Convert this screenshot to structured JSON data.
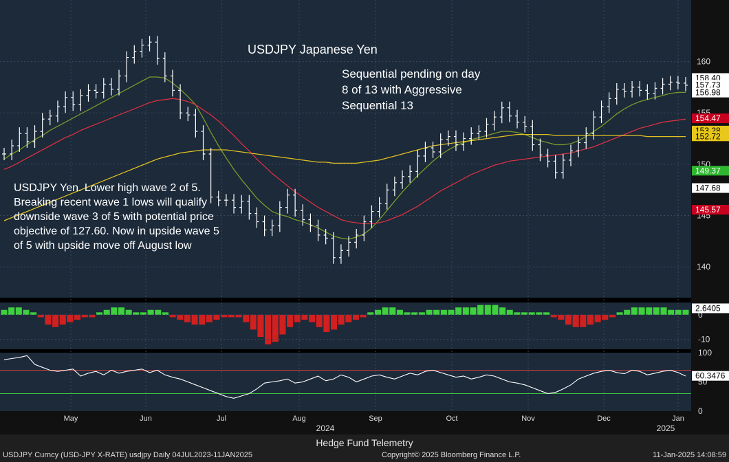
{
  "header": {
    "title": "USDJPY Japanese Yen",
    "sequential_note": [
      "Sequential pending on day",
      "8 of 13 with Aggressive",
      "Sequential 13"
    ],
    "wave_note": [
      "USDJPY Yen.  Lower high wave 2 of 5.",
      "Breaking recent wave 1 lows will qualify",
      "downside wave 3 of 5 with potential price",
      "objective of 127.60.  Now in upside wave 5",
      "of 5 with upside move off August low"
    ]
  },
  "footer": {
    "center": "Hedge Fund Telemetry",
    "security": "USDJPY Curncy (USD-JPY X-RATE) usdjpy  Daily 04JUL2023-11JAN2025",
    "copyright": "Copyright© 2025 Bloomberg Finance L.P.",
    "timestamp": "11-Jan-2025 14:08:59"
  },
  "colors": {
    "background": "#1c2a3a",
    "grid": "#3a4a5a",
    "price": "#ffffff",
    "ma_short": "#7a9a2a",
    "ma_mid": "#d83040",
    "ma_long": "#e0c020",
    "hist_pos": "#3fcf3f",
    "hist_neg": "#d02020",
    "rsi": "#ffffff",
    "label_red": "#c8001e",
    "label_yellow": "#e8c81a",
    "label_green": "#2fb82f",
    "label_white": "#ffffff"
  },
  "chart_data": [
    {
      "type": "line",
      "panel": "price",
      "x_ticks": [
        "May",
        "Jun",
        "Jul",
        "Aug",
        "Sep",
        "Oct",
        "Nov",
        "Dec",
        "Jan"
      ],
      "year_labels": [
        "2024",
        "2025"
      ],
      "ylim": [
        137,
        166
      ],
      "y_ticks": [
        140,
        145,
        150,
        155,
        160
      ],
      "price_labels": [
        {
          "value": "158.40",
          "color": "label_white"
        },
        {
          "value": "157.73",
          "color": "label_white"
        },
        {
          "value": "156.98",
          "color": "label_white"
        },
        {
          "value": "154.47",
          "color": "label_red"
        },
        {
          "value": "153.28",
          "color": "label_yellow"
        },
        {
          "value": "152.72",
          "color": "label_yellow"
        },
        {
          "value": "149.37",
          "color": "label_green"
        },
        {
          "value": "147.68",
          "color": "label_white"
        },
        {
          "value": "145.57",
          "color": "label_red"
        }
      ],
      "series": [
        {
          "key": "close",
          "values": [
            151.0,
            151.8,
            153.0,
            152.2,
            153.2,
            154.4,
            154.7,
            155.6,
            156.5,
            155.8,
            156.7,
            157.2,
            157.0,
            157.8,
            157.3,
            158.6,
            160.4,
            161.0,
            161.6,
            161.9,
            160.3,
            158.6,
            157.2,
            155.0,
            154.8,
            153.2,
            151.0,
            146.8,
            146.5,
            146.5,
            145.8,
            146.4,
            145.2,
            144.4,
            143.6,
            144.0,
            145.8,
            147.0,
            145.5,
            144.6,
            144.0,
            143.1,
            142.8,
            140.9,
            141.6,
            142.4,
            143.1,
            144.4,
            145.4,
            146.2,
            147.5,
            148.2,
            148.8,
            149.3,
            150.8,
            151.6,
            151.2,
            152.4,
            152.7,
            151.9,
            152.5,
            153.0,
            153.2,
            153.9,
            154.6,
            155.5,
            154.7,
            154.1,
            153.7,
            151.9,
            150.9,
            150.3,
            149.2,
            150.4,
            151.3,
            152.1,
            153.0,
            154.6,
            155.6,
            156.4,
            157.3,
            157.1,
            157.5,
            157.2,
            156.9,
            157.4,
            157.8,
            158.0,
            157.9,
            157.7
          ]
        },
        {
          "key": "ma_short",
          "values": [
            150.5,
            151.0,
            151.4,
            151.9,
            152.4,
            152.8,
            153.3,
            153.7,
            154.1,
            154.5,
            154.9,
            155.3,
            155.7,
            156.1,
            156.5,
            156.9,
            157.3,
            157.7,
            158.1,
            158.5,
            158.5,
            158.4,
            157.9,
            157.3,
            156.6,
            155.8,
            154.5,
            153.1,
            151.8,
            150.6,
            149.5,
            148.5,
            147.6,
            146.7,
            146.0,
            145.4,
            145.1,
            144.9,
            144.6,
            144.4,
            144.1,
            143.8,
            143.4,
            143.0,
            142.8,
            142.7,
            142.9,
            143.2,
            143.8,
            144.6,
            145.5,
            146.4,
            147.3,
            148.1,
            148.9,
            149.6,
            150.3,
            150.9,
            151.4,
            151.8,
            152.1,
            152.4,
            152.6,
            152.8,
            153.0,
            153.2,
            153.2,
            153.1,
            152.9,
            152.6,
            152.3,
            152.1,
            151.9,
            151.9,
            152.0,
            152.3,
            152.7,
            153.2,
            153.7,
            154.3,
            154.9,
            155.4,
            155.8,
            156.1,
            156.3,
            156.5,
            156.7,
            156.9,
            157.0,
            157.0
          ]
        },
        {
          "key": "ma_mid",
          "values": [
            149.5,
            149.8,
            150.2,
            150.6,
            151.0,
            151.4,
            151.8,
            152.2,
            152.6,
            152.9,
            153.3,
            153.6,
            153.9,
            154.2,
            154.5,
            154.8,
            155.1,
            155.4,
            155.7,
            156.0,
            156.2,
            156.3,
            156.4,
            156.3,
            156.1,
            155.8,
            155.3,
            154.8,
            154.2,
            153.5,
            152.8,
            152.0,
            151.3,
            150.5,
            149.8,
            149.1,
            148.5,
            147.9,
            147.3,
            146.8,
            146.3,
            145.8,
            145.4,
            145.0,
            144.6,
            144.4,
            144.3,
            144.2,
            144.2,
            144.3,
            144.5,
            144.8,
            145.1,
            145.5,
            145.9,
            146.4,
            146.9,
            147.4,
            147.8,
            148.2,
            148.6,
            149.0,
            149.3,
            149.6,
            149.9,
            150.1,
            150.3,
            150.4,
            150.5,
            150.6,
            150.7,
            150.8,
            150.9,
            151.0,
            151.1,
            151.3,
            151.5,
            151.7,
            152.0,
            152.3,
            152.6,
            152.9,
            153.2,
            153.5,
            153.7,
            153.9,
            154.1,
            154.2,
            154.3,
            154.4
          ]
        },
        {
          "key": "ma_long",
          "values": [
            144.5,
            144.8,
            145.1,
            145.4,
            145.7,
            146.0,
            146.3,
            146.6,
            146.9,
            147.2,
            147.5,
            147.8,
            148.1,
            148.4,
            148.7,
            149.0,
            149.3,
            149.6,
            149.9,
            150.2,
            150.5,
            150.7,
            150.9,
            151.1,
            151.2,
            151.3,
            151.4,
            151.4,
            151.4,
            151.4,
            151.3,
            151.2,
            151.1,
            151.0,
            150.9,
            150.8,
            150.7,
            150.6,
            150.5,
            150.4,
            150.3,
            150.2,
            150.2,
            150.1,
            150.1,
            150.1,
            150.1,
            150.2,
            150.3,
            150.4,
            150.6,
            150.8,
            151.0,
            151.2,
            151.4,
            151.6,
            151.8,
            151.9,
            152.0,
            152.1,
            152.2,
            152.3,
            152.4,
            152.5,
            152.6,
            152.7,
            152.8,
            152.9,
            152.9,
            152.9,
            152.9,
            152.9,
            152.8,
            152.8,
            152.8,
            152.8,
            152.8,
            152.8,
            152.8,
            152.8,
            152.8,
            152.8,
            152.8,
            152.8,
            152.7,
            152.7,
            152.7,
            152.7,
            152.7,
            152.7
          ]
        }
      ]
    },
    {
      "type": "bar",
      "panel": "histogram",
      "last_value": "2.6405",
      "y_ticks": [
        0,
        -10
      ],
      "ylim": [
        -14,
        5
      ],
      "values": [
        2,
        3,
        3,
        2,
        1,
        -1,
        -4,
        -5,
        -4,
        -3,
        -2,
        -1,
        -1,
        1,
        2,
        3,
        3,
        2,
        1,
        1,
        2,
        2,
        1,
        -1,
        -2,
        -3,
        -4,
        -4,
        -3,
        -2,
        -1,
        -1,
        -1,
        -3,
        -6,
        -9,
        -12,
        -11,
        -8,
        -5,
        -3,
        -2,
        -3,
        -5,
        -7,
        -6,
        -4,
        -3,
        -2,
        -1,
        1,
        2,
        3,
        3,
        2,
        1,
        1,
        1,
        2,
        2,
        2,
        2,
        3,
        3,
        3,
        4,
        4,
        4,
        3,
        2,
        1,
        1,
        1,
        1,
        1,
        -1,
        -2,
        -4,
        -5,
        -5,
        -4,
        -3,
        -2,
        -1,
        1,
        2,
        3,
        3,
        3,
        3,
        3,
        2,
        2,
        2
      ]
    },
    {
      "type": "area",
      "panel": "rsi",
      "last_value": "60.3476",
      "y_ticks": [
        0,
        50,
        100
      ],
      "ylim": [
        0,
        100
      ],
      "overbought": 70,
      "oversold": 30,
      "values": [
        88,
        90,
        92,
        95,
        80,
        75,
        70,
        68,
        70,
        72,
        60,
        65,
        68,
        62,
        70,
        65,
        68,
        70,
        72,
        66,
        70,
        62,
        58,
        55,
        50,
        45,
        40,
        35,
        30,
        25,
        22,
        26,
        30,
        38,
        48,
        50,
        52,
        55,
        48,
        50,
        55,
        60,
        52,
        55,
        62,
        58,
        50,
        55,
        60,
        62,
        58,
        55,
        60,
        65,
        62,
        68,
        70,
        66,
        62,
        58,
        60,
        55,
        58,
        62,
        60,
        55,
        50,
        48,
        45,
        40,
        35,
        30,
        32,
        38,
        45,
        55,
        60,
        65,
        68,
        70,
        66,
        64,
        70,
        68,
        62,
        65,
        68,
        70,
        66,
        60
      ]
    }
  ]
}
